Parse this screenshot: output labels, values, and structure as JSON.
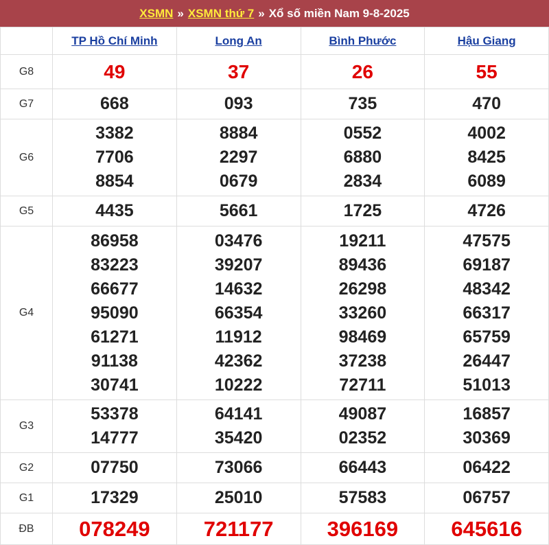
{
  "header": {
    "link1": "XSMN",
    "sep1": "»",
    "link2": "XSMN thứ 7",
    "sep2": "»",
    "title": "Xổ số miền Nam 9-8-2025"
  },
  "provinces": [
    "TP Hồ Chí Minh",
    "Long An",
    "Bình Phước",
    "Hậu Giang"
  ],
  "prizes": [
    {
      "label": "G8",
      "results": [
        [
          "49"
        ],
        [
          "37"
        ],
        [
          "26"
        ],
        [
          "55"
        ]
      ]
    },
    {
      "label": "G7",
      "results": [
        [
          "668"
        ],
        [
          "093"
        ],
        [
          "735"
        ],
        [
          "470"
        ]
      ]
    },
    {
      "label": "G6",
      "results": [
        [
          "3382",
          "7706",
          "8854"
        ],
        [
          "8884",
          "2297",
          "0679"
        ],
        [
          "0552",
          "6880",
          "2834"
        ],
        [
          "4002",
          "8425",
          "6089"
        ]
      ]
    },
    {
      "label": "G5",
      "results": [
        [
          "4435"
        ],
        [
          "5661"
        ],
        [
          "1725"
        ],
        [
          "4726"
        ]
      ]
    },
    {
      "label": "G4",
      "results": [
        [
          "86958",
          "83223",
          "66677",
          "95090",
          "61271",
          "91138",
          "30741"
        ],
        [
          "03476",
          "39207",
          "14632",
          "66354",
          "11912",
          "42362",
          "10222"
        ],
        [
          "19211",
          "89436",
          "26298",
          "33260",
          "98469",
          "37238",
          "72711"
        ],
        [
          "47575",
          "69187",
          "48342",
          "66317",
          "65759",
          "26447",
          "51013"
        ]
      ]
    },
    {
      "label": "G3",
      "results": [
        [
          "53378",
          "14777"
        ],
        [
          "64141",
          "35420"
        ],
        [
          "49087",
          "02352"
        ],
        [
          "16857",
          "30369"
        ]
      ]
    },
    {
      "label": "G2",
      "results": [
        [
          "07750"
        ],
        [
          "73066"
        ],
        [
          "66443"
        ],
        [
          "06422"
        ]
      ]
    },
    {
      "label": "G1",
      "results": [
        [
          "17329"
        ],
        [
          "25010"
        ],
        [
          "57583"
        ],
        [
          "06757"
        ]
      ]
    },
    {
      "label": "ĐB",
      "results": [
        [
          "078249"
        ],
        [
          "721177"
        ],
        [
          "396169"
        ],
        [
          "645616"
        ]
      ]
    }
  ]
}
